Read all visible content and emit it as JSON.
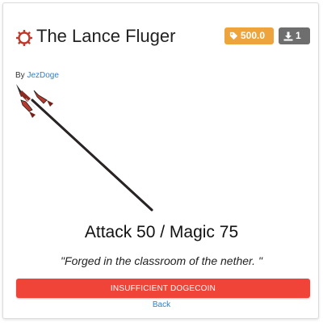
{
  "item": {
    "name": "The Lance Fluger",
    "author_prefix": "By",
    "author": "JezDoge",
    "stats": "Attack 50 / Magic 75",
    "quote": "\"Forged in the classroom of the nether. \"",
    "icon": "gear-ring-icon",
    "image": "spear-image"
  },
  "badges": {
    "price": "500.0",
    "price_icon": "tag-icon",
    "downloads": "1",
    "downloads_icon": "download-icon"
  },
  "actions": {
    "buy_label": "INSUFFICIENT DOGECOIN",
    "back_label": "Back"
  },
  "colors": {
    "accent": "#f04438",
    "price_badge": "#eda43d",
    "download_badge": "#6e6e6e",
    "link": "#2a7fd4",
    "title_icon": "#c0392b"
  }
}
